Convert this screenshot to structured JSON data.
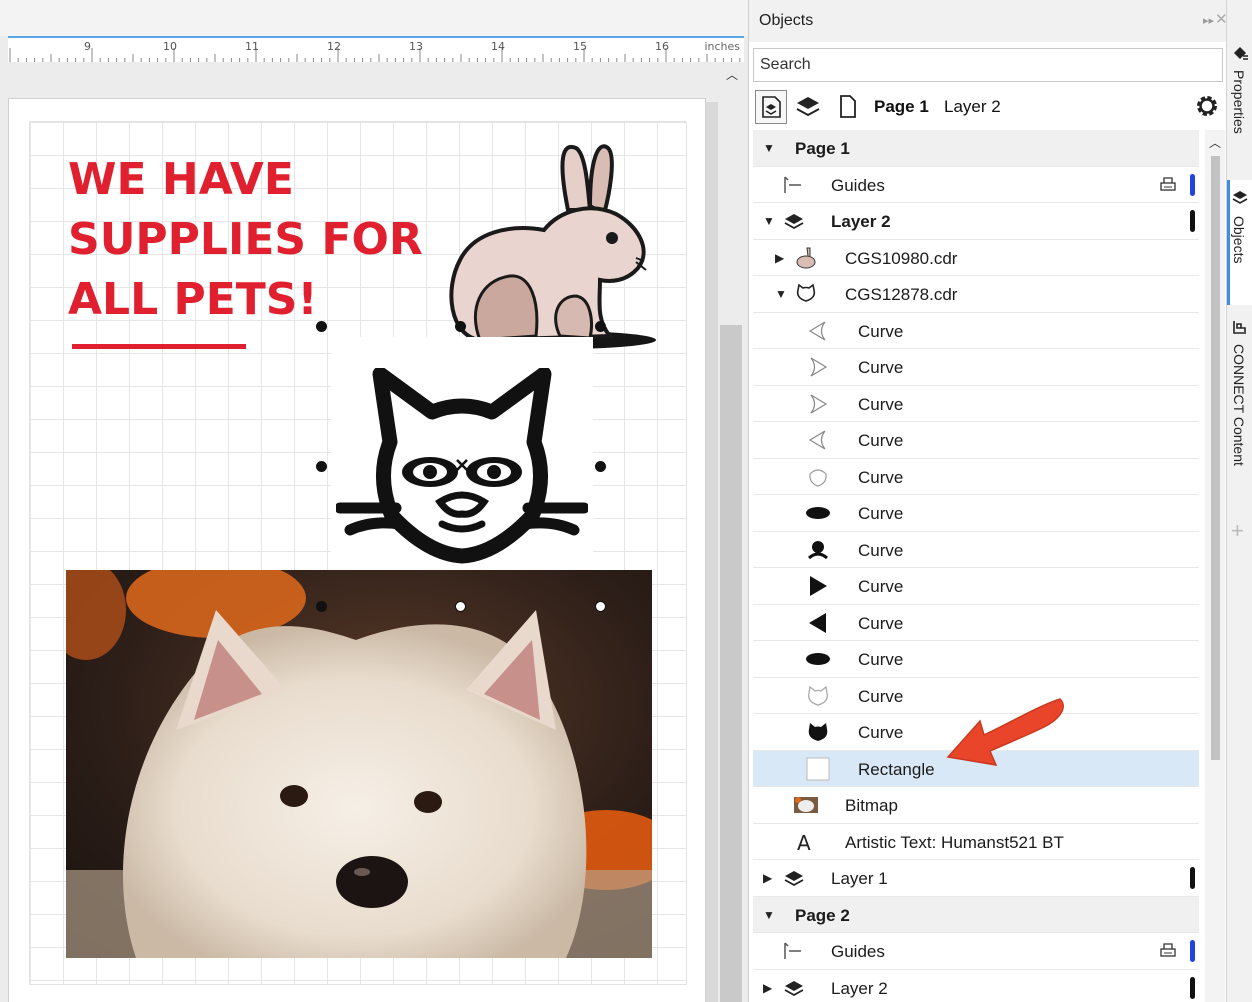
{
  "ruler": {
    "numbers": [
      "9",
      "10",
      "11",
      "12",
      "13",
      "14",
      "15",
      "16"
    ],
    "units": "inches"
  },
  "canvas": {
    "headline": [
      "WE HAVE",
      "SUPPLIES FOR",
      "ALL PETS!"
    ]
  },
  "colors": {
    "accent_red": "#e0202e",
    "selection_blue": "#d8e8f6",
    "arrow": "#e8452a"
  },
  "panel": {
    "title": "Objects",
    "search_placeholder": "Search",
    "toolbar": {
      "page_label": "Page 1",
      "layer_label": "Layer 2"
    }
  },
  "tree": [
    {
      "kind": "page",
      "label": "Page 1",
      "twisty": "▼",
      "icon": "none",
      "indent": 0
    },
    {
      "kind": "guides",
      "label": "Guides",
      "twisty": "",
      "icon": "guides-icon",
      "indent": 1,
      "print": true,
      "flag": "blue"
    },
    {
      "kind": "layer",
      "label": "Layer 2",
      "twisty": "▼",
      "icon": "layer-icon",
      "indent": 1,
      "flag": "black",
      "bold": true
    },
    {
      "kind": "group",
      "label": "CGS10980.cdr",
      "twisty": "▶",
      "icon": "rabbit-thumb-icon",
      "indent": 2
    },
    {
      "kind": "group",
      "label": "CGS12878.cdr",
      "twisty": "▼",
      "icon": "cat-thumb-icon",
      "indent": 2
    },
    {
      "kind": "curve",
      "label": "Curve",
      "icon": "ear-left-outline-icon",
      "indent": 3
    },
    {
      "kind": "curve",
      "label": "Curve",
      "icon": "ear-right-outline-icon",
      "indent": 3
    },
    {
      "kind": "curve",
      "label": "Curve",
      "icon": "ear-right-outline-icon",
      "indent": 3
    },
    {
      "kind": "curve",
      "label": "Curve",
      "icon": "ear-left-outline-icon",
      "indent": 3
    },
    {
      "kind": "curve",
      "label": "Curve",
      "icon": "oval-outline-icon",
      "indent": 3
    },
    {
      "kind": "curve",
      "label": "Curve",
      "icon": "eye-filled-icon",
      "indent": 3
    },
    {
      "kind": "curve",
      "label": "Curve",
      "icon": "nose-mouth-icon",
      "indent": 3
    },
    {
      "kind": "curve",
      "label": "Curve",
      "icon": "triangle-right-icon",
      "indent": 3
    },
    {
      "kind": "curve",
      "label": "Curve",
      "icon": "triangle-left-icon",
      "indent": 3
    },
    {
      "kind": "curve",
      "label": "Curve",
      "icon": "eye-filled-icon",
      "indent": 3
    },
    {
      "kind": "curve",
      "label": "Curve",
      "icon": "cat-outline-icon",
      "indent": 3
    },
    {
      "kind": "curve",
      "label": "Curve",
      "icon": "cat-filled-icon",
      "indent": 3
    },
    {
      "kind": "rect",
      "label": "Rectangle",
      "icon": "rectangle-icon",
      "indent": 3,
      "selected": true
    },
    {
      "kind": "bitmap",
      "label": "Bitmap",
      "icon": "bitmap-thumb-icon",
      "indent": 2
    },
    {
      "kind": "text",
      "label": "Artistic Text: Humanst521 BT",
      "icon": "text-a-icon",
      "indent": 2
    },
    {
      "kind": "layer",
      "label": "Layer 1",
      "twisty": "▶",
      "icon": "layer-icon",
      "indent": 1,
      "flag": "black"
    },
    {
      "kind": "page",
      "label": "Page 2",
      "twisty": "▼",
      "icon": "none",
      "indent": 0
    },
    {
      "kind": "guides",
      "label": "Guides",
      "twisty": "",
      "icon": "guides-icon",
      "indent": 1,
      "print": true,
      "flag": "blue"
    },
    {
      "kind": "layer",
      "label": "Layer 2",
      "twisty": "▶",
      "icon": "layer-icon",
      "indent": 1,
      "flag": "black"
    }
  ],
  "dock": {
    "tabs": [
      "Properties",
      "Objects",
      "CONNECT Content"
    ],
    "add_label": "+"
  }
}
